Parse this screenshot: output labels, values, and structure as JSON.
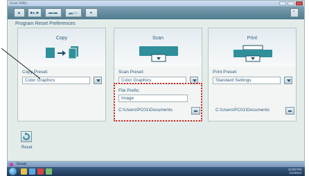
{
  "window": {
    "title": "Scan Utility",
    "toolbar_buttons": [
      "home-icon",
      "copy-mode-icon",
      "scan-mode-icon",
      "print-mode-icon",
      "settings-icon"
    ],
    "right_button": "help-icon"
  },
  "heading": "Program Reset Preferences",
  "panels": {
    "copy": {
      "title": "Copy",
      "preset_label": "Copy Preset:",
      "preset_value": "Color Graphics"
    },
    "scan": {
      "title": "Scan",
      "preset_label": "Scan Preset:",
      "preset_value": "Color Graphics",
      "prefix_label": "File Prefix:",
      "prefix_value": "Image",
      "path": "C:\\Users\\PC01\\Documents"
    },
    "print": {
      "title": "Print",
      "preset_label": "Print Preset:",
      "preset_value": "Standard Settings",
      "path": "C:\\Users\\PC01\\Documents"
    }
  },
  "reset": {
    "label": "Reset"
  },
  "statusbar": {
    "text": "Ready"
  },
  "taskbar": {
    "time": "12:00 PM",
    "date": "1/1/2012"
  },
  "colors": {
    "accent": "#2d5b7c",
    "icon": "#2f8f9a",
    "highlight": "#d8231f"
  }
}
